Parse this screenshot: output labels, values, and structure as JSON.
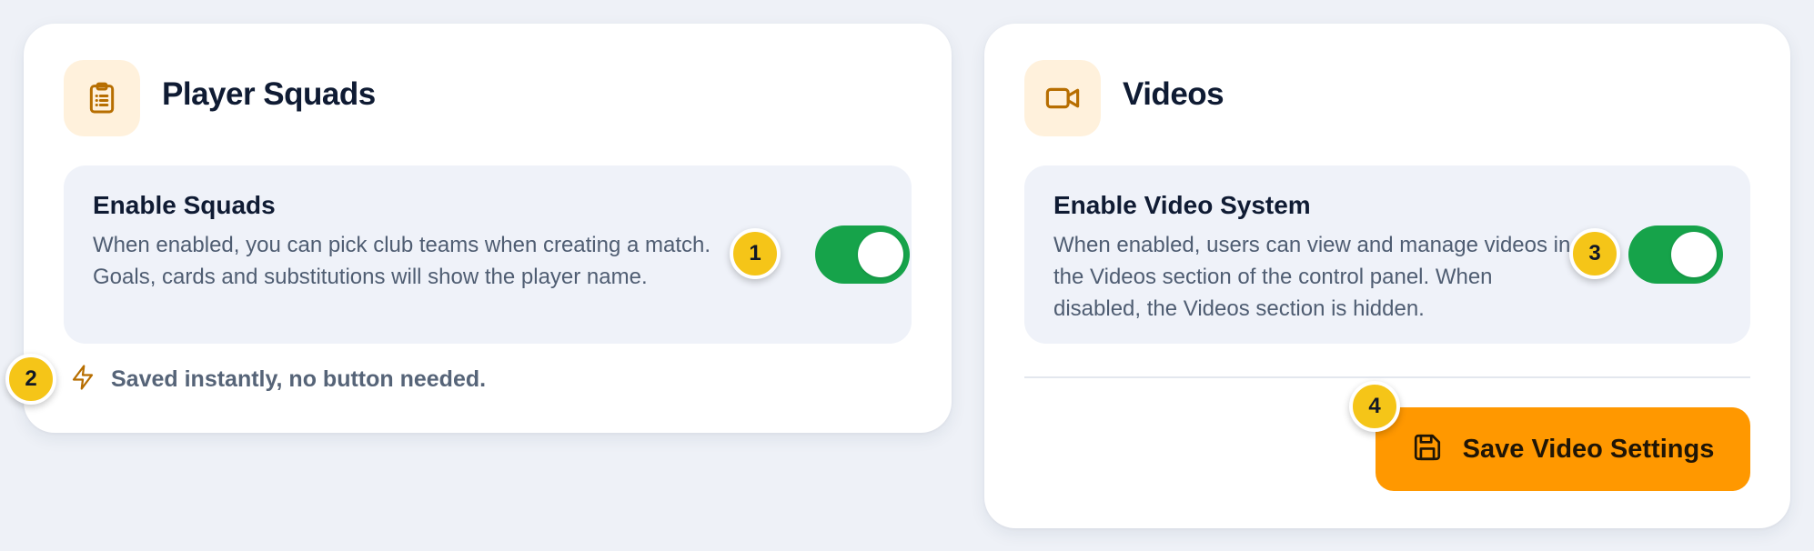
{
  "squads_card": {
    "title": "Player Squads",
    "icon": "clipboard-list-icon",
    "setting": {
      "title": "Enable Squads",
      "description": "When enabled, you can pick club teams when creating a match. Goals, cards and substitutions will show the player name.",
      "enabled": true
    },
    "saved_note": "Saved instantly, no button needed.",
    "saved_note_icon": "lightning-icon"
  },
  "videos_card": {
    "title": "Videos",
    "icon": "video-camera-icon",
    "setting": {
      "title": "Enable Video System",
      "description": "When enabled, users can view and manage videos in the Videos section of the control panel. When disabled, the Videos section is hidden.",
      "enabled": true
    },
    "save_button_label": "Save Video Settings",
    "save_button_icon": "floppy-disk-icon"
  },
  "badges": [
    "1",
    "2",
    "3",
    "4"
  ],
  "colors": {
    "accent": "#ff9800",
    "toggle_on": "#16a34a",
    "badge": "#f5c518",
    "icon_bg": "#fff1dc",
    "icon_stroke": "#b76e00"
  }
}
